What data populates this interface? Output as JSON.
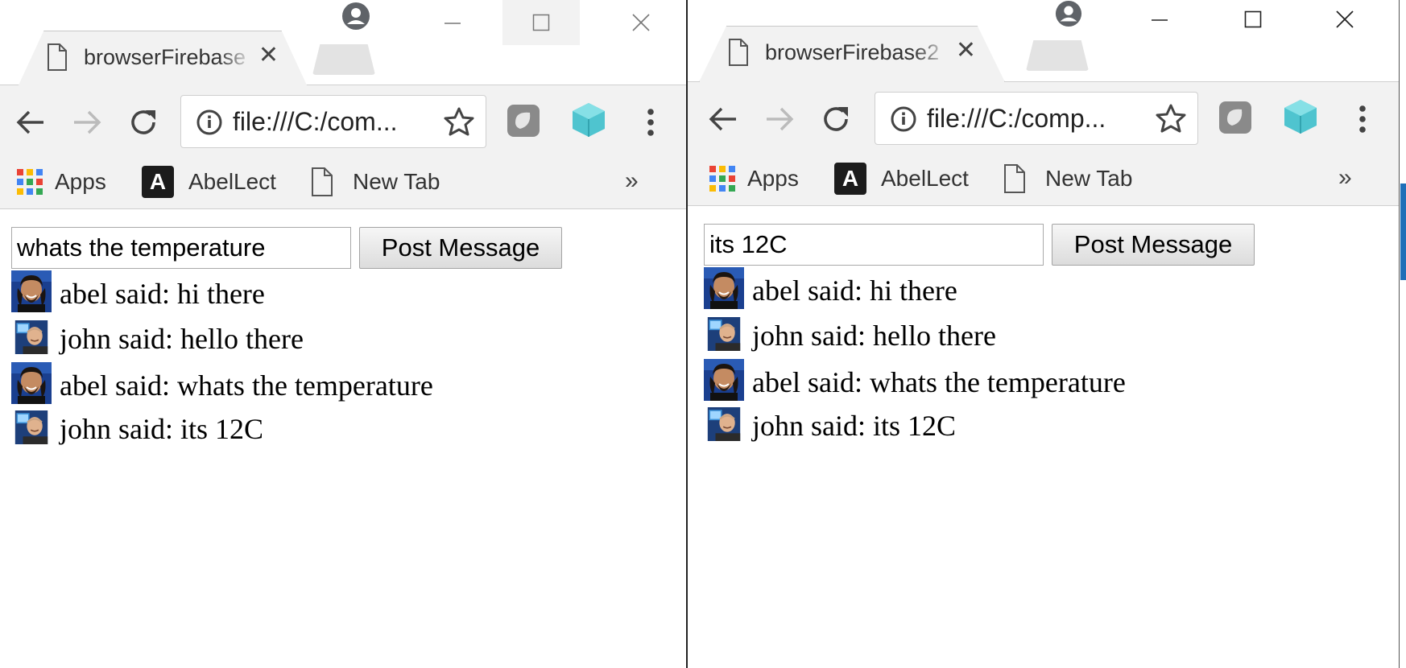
{
  "windows": [
    {
      "id": "left",
      "tab_title": "browserFirebase",
      "tab_close": "✕",
      "url": "file:///C:/com...",
      "bookmarks": {
        "apps": "Apps",
        "abellect": "AbelLect",
        "abellect_badge": "A",
        "newtab": "New Tab",
        "more": "»"
      },
      "input_value": "whats the temperature",
      "post_button": "Post Message",
      "messages": [
        {
          "user": "abel",
          "text": "abel said: hi there"
        },
        {
          "user": "john",
          "text": "john said: hello there"
        },
        {
          "user": "abel",
          "text": "abel said: whats the temperature"
        },
        {
          "user": "john",
          "text": "john said: its 12C"
        }
      ]
    },
    {
      "id": "right",
      "tab_title": "browserFirebase2",
      "tab_close": "✕",
      "url": "file:///C:/comp...",
      "bookmarks": {
        "apps": "Apps",
        "abellect": "AbelLect",
        "abellect_badge": "A",
        "newtab": "New Tab",
        "more": "»"
      },
      "input_value": "its 12C",
      "post_button": "Post Message",
      "messages": [
        {
          "user": "abel",
          "text": "abel said: hi there"
        },
        {
          "user": "john",
          "text": "john said: hello there"
        },
        {
          "user": "abel",
          "text": "abel said: whats the temperature"
        },
        {
          "user": "john",
          "text": "john said: its 12C"
        }
      ]
    }
  ],
  "icons": {
    "page": "page-icon",
    "back": "back-arrow-icon",
    "forward": "forward-arrow-icon",
    "reload": "reload-icon",
    "info": "info-icon",
    "star": "star-icon",
    "extension1": "shield-extension-icon",
    "extension2": "cube-extension-icon",
    "menu": "kebab-menu-icon",
    "profile": "profile-icon",
    "apps": "apps-grid-icon"
  },
  "colors": {
    "toolbar_bg": "#f2f2f2",
    "cube": "#4fc4cf",
    "apps_grid": [
      "#ea4335",
      "#4285f4",
      "#fbbc05",
      "#34a853"
    ]
  }
}
